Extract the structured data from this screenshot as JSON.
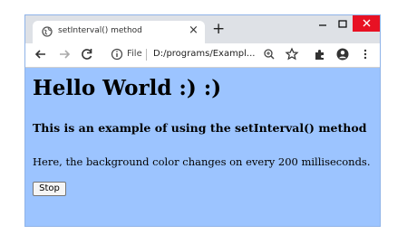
{
  "browser": {
    "tab_title": "setInterval() method",
    "tab_close": "×",
    "new_tab": "+",
    "file_label": "File",
    "url": "D:/programs/Exampl..."
  },
  "page": {
    "heading": "Hello World :) :)",
    "subheading": "This is an example of using the setInterval() method",
    "description": "Here, the background color changes on every 200 milliseconds.",
    "stop_button": "Stop"
  },
  "icons": {
    "tab": "globe-icon",
    "back": "back-arrow-icon",
    "forward": "forward-arrow-icon",
    "reload": "reload-icon",
    "info": "info-icon",
    "zoom": "zoom-icon",
    "bookmark": "star-icon",
    "extensions": "puzzle-icon",
    "profile": "profile-icon",
    "menu": "kebab-menu-icon",
    "minimize": "minimize-icon",
    "maximize": "maximize-icon",
    "close": "close-icon"
  },
  "colors": {
    "page_background": "#9cc4ff",
    "window_close": "#e81123"
  }
}
